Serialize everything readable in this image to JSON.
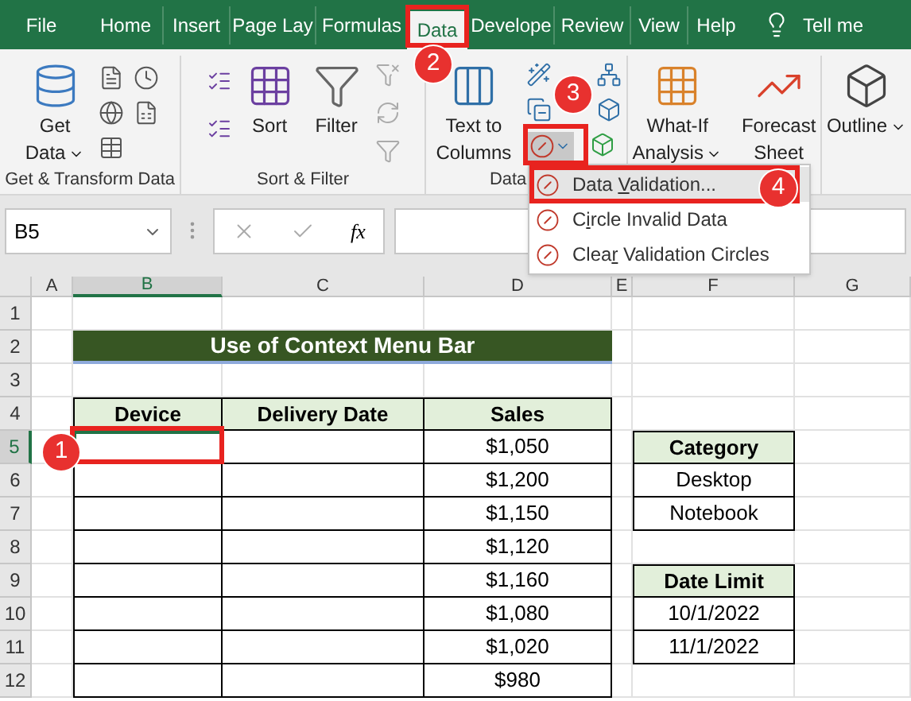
{
  "ribbon_tabs": [
    {
      "label": "File",
      "selected": false
    },
    {
      "label": "Home",
      "selected": false
    },
    {
      "label": "Insert",
      "selected": false
    },
    {
      "label": "Page Lay",
      "selected": false
    },
    {
      "label": "Formulas",
      "selected": false
    },
    {
      "label": "Data",
      "selected": true
    },
    {
      "label": "Develope",
      "selected": false
    },
    {
      "label": "Review",
      "selected": false
    },
    {
      "label": "View",
      "selected": false
    },
    {
      "label": "Help",
      "selected": false
    }
  ],
  "tell_me": "Tell me",
  "ribbon": {
    "get_data": [
      "Get",
      "Data"
    ],
    "sort": "Sort",
    "filter": "Filter",
    "text_to_columns": [
      "Text to",
      "Columns"
    ],
    "what_if": [
      "What-If",
      "Analysis"
    ],
    "forecast": [
      "Forecast",
      "Sheet"
    ],
    "outline": "Outline",
    "group_labels": [
      "Get & Transform Data",
      "Sort & Filter",
      "Data"
    ]
  },
  "name_box": "B5",
  "fx": "fx",
  "validation_menu": [
    {
      "parts": [
        "Data ",
        "V",
        "alidation..."
      ],
      "highlighted": true
    },
    {
      "parts": [
        "C",
        "i",
        "rcle Invalid Data"
      ],
      "highlighted": false
    },
    {
      "parts": [
        "Clea",
        "r",
        " Validation Circles"
      ],
      "highlighted": false
    }
  ],
  "sheet": {
    "columns": [
      {
        "label": "A",
        "selected": false
      },
      {
        "label": "B",
        "selected": true
      },
      {
        "label": "C",
        "selected": false
      },
      {
        "label": "D",
        "selected": false
      },
      {
        "label": "E",
        "selected": false
      },
      {
        "label": "F",
        "selected": false
      },
      {
        "label": "G",
        "selected": false
      }
    ],
    "rows": [
      {
        "label": "1",
        "selected": false
      },
      {
        "label": "2",
        "selected": false
      },
      {
        "label": "3",
        "selected": false
      },
      {
        "label": "4",
        "selected": false
      },
      {
        "label": "5",
        "selected": true
      },
      {
        "label": "6",
        "selected": false
      },
      {
        "label": "7",
        "selected": false
      },
      {
        "label": "8",
        "selected": false
      },
      {
        "label": "9",
        "selected": false
      },
      {
        "label": "10",
        "selected": false
      },
      {
        "label": "11",
        "selected": false
      },
      {
        "label": "12",
        "selected": false
      }
    ],
    "title": "Use of Context Menu Bar",
    "main_table": {
      "headers": [
        "Device",
        "Delivery Date",
        "Sales"
      ],
      "rows": [
        {
          "sales": "$1,050",
          "selected": true
        },
        {
          "sales": "$1,200",
          "selected": false
        },
        {
          "sales": "$1,150",
          "selected": false
        },
        {
          "sales": "$1,120",
          "selected": false
        },
        {
          "sales": "$1,160",
          "selected": false
        },
        {
          "sales": "$1,080",
          "selected": false
        },
        {
          "sales": "$1,020",
          "selected": false
        },
        {
          "sales": "$980",
          "selected": false
        }
      ]
    },
    "category_table": {
      "header": "Category",
      "rows": [
        "Desktop",
        "Notebook"
      ]
    },
    "date_table": {
      "header": "Date Limit",
      "rows": [
        "10/1/2022",
        "11/1/2022"
      ]
    }
  },
  "callouts": [
    "1",
    "2",
    "3",
    "4"
  ]
}
